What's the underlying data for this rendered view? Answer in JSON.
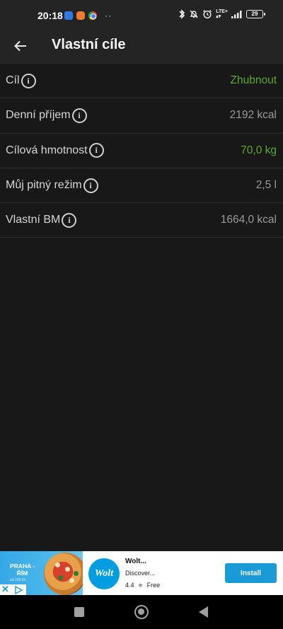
{
  "status_bar": {
    "time": "20:18",
    "dots": "··",
    "network": "LTE+",
    "battery": "29",
    "icons": [
      "message-icon",
      "app-notification-icon",
      "chrome-icon",
      "bluetooth-icon",
      "mute-icon",
      "alarm-icon",
      "signal-icon",
      "battery-icon"
    ]
  },
  "app_bar": {
    "title": "Vlastní cíle",
    "back_icon": "arrow-left-icon"
  },
  "rows": [
    {
      "label": "Cíl",
      "value": "Zhubnout",
      "accent": true
    },
    {
      "label": "Denní příjem",
      "value": "2192 kcal",
      "accent": false
    },
    {
      "label": "Cílová hmotnost",
      "value": "70,0 kg",
      "accent": true
    },
    {
      "label": "Můj pitný režim",
      "value": "2,5 l",
      "accent": false
    },
    {
      "label": "Vlastní BM",
      "value": "1664,0 kcal",
      "accent": false
    }
  ],
  "info_glyph": "i",
  "ad": {
    "image_title": "PRAHA -\nŘÍM",
    "image_sub": "od 169 Kč",
    "logo_text": "Wolt",
    "name": "Wolt...",
    "description": "Discover...",
    "rating": "4.4",
    "price": "Free",
    "install_label": "Install",
    "close_glyph": "✕"
  },
  "colors": {
    "accent_green": "#5ea82c",
    "background": "#181818",
    "app_bar": "#242424",
    "install_blue": "#1a9bd7"
  }
}
